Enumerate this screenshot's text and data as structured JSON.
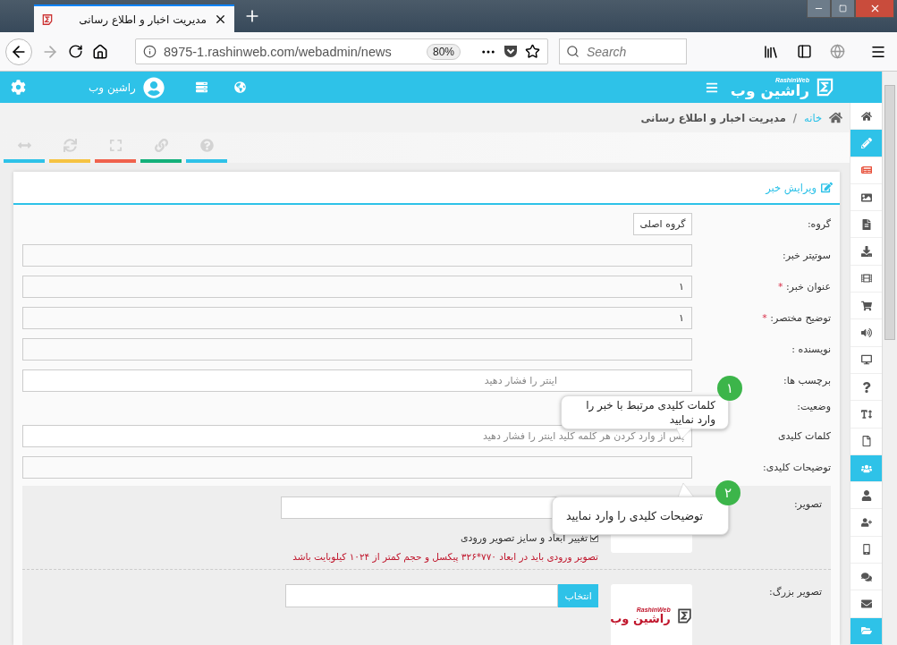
{
  "browser": {
    "tab_title": "مدیریت اخبار و اطلاع رسانی",
    "url": "8975-1.rashinweb.com/webadmin/news",
    "zoom": "80%",
    "search": {
      "placeholder": "Search"
    }
  },
  "header": {
    "user": "راشین وب",
    "logo": {
      "name": "راشین وب",
      "tagline": "RashinWeb"
    }
  },
  "breadcrumb": [
    {
      "label": "خانه",
      "kind": "link"
    },
    {
      "label": "/",
      "kind": "separator"
    },
    {
      "label": "مدیریت اخبار و اطلاع رسانی",
      "kind": "current"
    }
  ],
  "tools": [
    {
      "color": "#2ec2e8"
    },
    {
      "color": "#f6c342"
    },
    {
      "color": "#f0624d"
    },
    {
      "color": "#13b07a"
    },
    {
      "color": "#2ec2e8"
    }
  ],
  "sidebar": {
    "items": [
      {
        "selected": false
      },
      {
        "selected": true
      },
      {
        "selected": false
      },
      {
        "selected": false
      },
      {
        "selected": false
      },
      {
        "selected": false
      },
      {
        "selected": false
      },
      {
        "selected": false
      },
      {
        "selected": false
      },
      {
        "selected": false
      },
      {
        "selected": false
      },
      {
        "selected": false
      },
      {
        "selected": false
      },
      {
        "selected": true
      },
      {
        "selected": false
      },
      {
        "selected": false
      },
      {
        "selected": false
      },
      {
        "selected": false
      },
      {
        "selected": false
      },
      {
        "selected": true
      }
    ]
  },
  "card": {
    "title": "ویرایش خبر"
  },
  "form": {
    "required_mark": "*",
    "rows": [
      {
        "label": "گروه:",
        "kind": "select",
        "value": "گروه اصلی",
        "required": false
      },
      {
        "label": "سوتیتر خبر:",
        "kind": "text",
        "required": false
      },
      {
        "label": "عنوان خبر:",
        "kind": "text",
        "value": "۱",
        "required": true
      },
      {
        "label": "توضیح مختصر:",
        "kind": "text",
        "value": "۱",
        "required": true
      },
      {
        "label": "نویسنده :",
        "kind": "text",
        "required": false
      },
      {
        "label": "برچسب ها:",
        "kind": "tags",
        "placeholder": "اینتر را فشار دهید",
        "required": false
      },
      {
        "label": "وضعیت:",
        "kind": "label",
        "required": false
      },
      {
        "label": "کلمات کلیدی",
        "kind": "keywords",
        "placeholder": "پس از وارد کردن هر کلمه کلید اینتر را فشار دهید",
        "required": false
      },
      {
        "label": "توضیحات کلیدی:",
        "kind": "text",
        "required": false
      }
    ]
  },
  "image": {
    "label": "تصویر:",
    "option": "تغییر ابعاد و سایز تصویر ورودی",
    "checked": true,
    "note": "تصویر ورودی باید در ابعاد ۷۷۰*۳۲۶ پیکسل و حجم کمتر از ۱۰۲۴ کیلوبایت باشد"
  },
  "large_image": {
    "label": "تصویر بزرگ:",
    "button": "انتخاب",
    "logo": {
      "name": "راشین وب",
      "tagline": "RashinWeb"
    }
  },
  "tooltips": [
    {
      "badge": "۱",
      "text": "کلمات کلیدی مرتبط با خبر را وارد نمایید"
    },
    {
      "badge": "۲",
      "text": "توضیحات کلیدی را وارد نمایید"
    }
  ]
}
